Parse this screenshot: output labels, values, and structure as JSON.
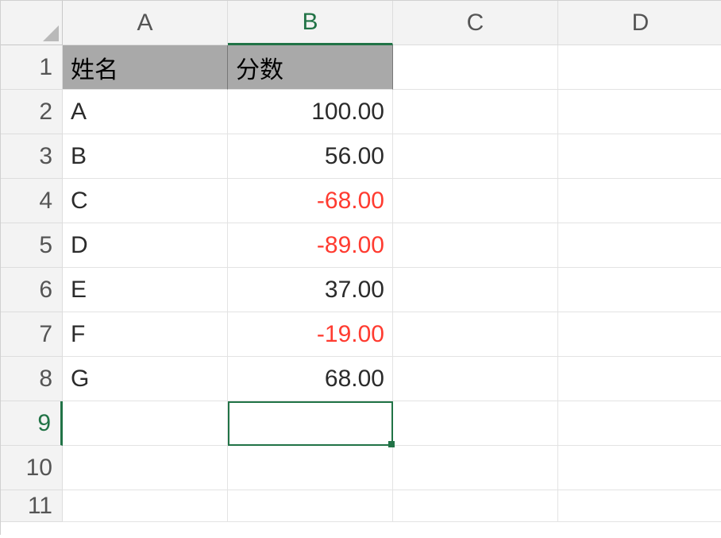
{
  "columns": [
    "A",
    "B",
    "C",
    "D"
  ],
  "row_numbers": [
    "1",
    "2",
    "3",
    "4",
    "5",
    "6",
    "7",
    "8",
    "9",
    "10",
    "11"
  ],
  "headers": {
    "a": "姓名",
    "b": "分数"
  },
  "rows": [
    {
      "name": "A",
      "score": "100.00",
      "neg": false
    },
    {
      "name": "B",
      "score": "56.00",
      "neg": false
    },
    {
      "name": "C",
      "score": "-68.00",
      "neg": true
    },
    {
      "name": "D",
      "score": "-89.00",
      "neg": true
    },
    {
      "name": "E",
      "score": "37.00",
      "neg": false
    },
    {
      "name": "F",
      "score": "-19.00",
      "neg": true
    },
    {
      "name": "G",
      "score": "68.00",
      "neg": false
    }
  ],
  "active_cell": "B9"
}
